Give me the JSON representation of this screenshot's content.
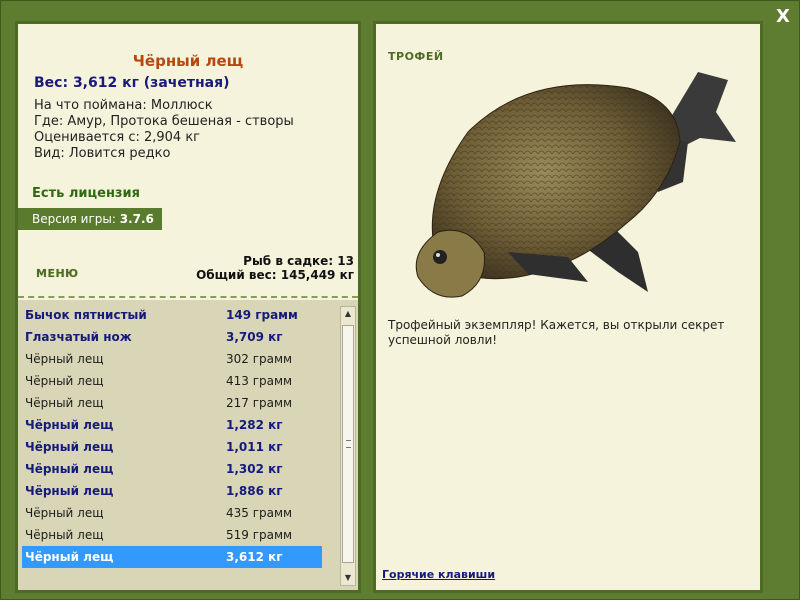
{
  "window": {
    "close_label": "X"
  },
  "fish_info": {
    "title": "Чёрный лещ",
    "weight": "Вес: 3,612 кг (зачетная)",
    "caught_on": "На что поймана: Моллюск",
    "location": "Где: Амур, Протока бешеная - створы",
    "value": "Оценивается с: 2,904 кг",
    "kind": "Вид: Ловится редко"
  },
  "license": "Есть лицензия",
  "version": {
    "label": "Версия игры:",
    "value": "3.7.6"
  },
  "menu_label": "МЕНЮ",
  "cage": {
    "count": "Рыб в садке: 13",
    "total": "Общий вес: 145,449 кг"
  },
  "catch_list": [
    {
      "name": "Бычок пятнистый",
      "weight": "149 грамм",
      "highlight": true,
      "selected": false
    },
    {
      "name": "Глазчатый нож",
      "weight": "3,709 кг",
      "highlight": true,
      "selected": false
    },
    {
      "name": "Чёрный лещ",
      "weight": "302 грамм",
      "highlight": false,
      "selected": false
    },
    {
      "name": "Чёрный лещ",
      "weight": "413 грамм",
      "highlight": false,
      "selected": false
    },
    {
      "name": "Чёрный лещ",
      "weight": "217 грамм",
      "highlight": false,
      "selected": false
    },
    {
      "name": "Чёрный лещ",
      "weight": "1,282 кг",
      "highlight": true,
      "selected": false
    },
    {
      "name": "Чёрный лещ",
      "weight": "1,011 кг",
      "highlight": true,
      "selected": false
    },
    {
      "name": "Чёрный лещ",
      "weight": "1,302 кг",
      "highlight": true,
      "selected": false
    },
    {
      "name": "Чёрный лещ",
      "weight": "1,886 кг",
      "highlight": true,
      "selected": false
    },
    {
      "name": "Чёрный лещ",
      "weight": "435 грамм",
      "highlight": false,
      "selected": false
    },
    {
      "name": "Чёрный лещ",
      "weight": "519 грамм",
      "highlight": false,
      "selected": false
    },
    {
      "name": "Чёрный лещ",
      "weight": "3,612 кг",
      "highlight": true,
      "selected": true
    }
  ],
  "trophy": {
    "label": "ТРОФЕЙ",
    "text": "Трофейный экземпляр! Кажется, вы открыли секрет успешной ловли!"
  },
  "hotkeys_label": "Горячие клавиши",
  "icons": {
    "close": "close-icon",
    "scroll_up": "arrow-up-icon",
    "scroll_down": "arrow-down-icon"
  },
  "colors": {
    "frame": "#5e7d30",
    "panel": "#f6f3dc",
    "title": "#b8460f",
    "highlight_text": "#151b7a",
    "selection": "#3399ff"
  }
}
